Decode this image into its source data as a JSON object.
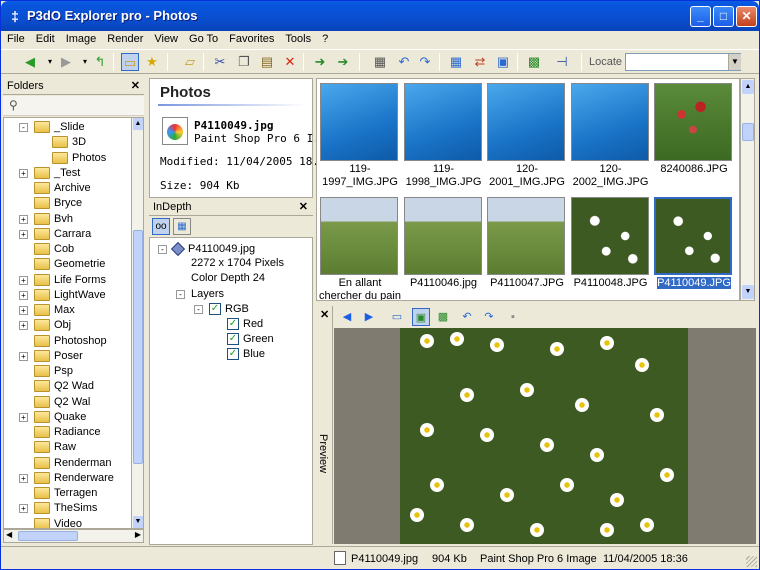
{
  "window": {
    "title": "P3dO Explorer pro - Photos",
    "app_glyph": "‡"
  },
  "menu": [
    "File",
    "Edit",
    "Image",
    "Render",
    "View",
    "Go To",
    "Favorites",
    "Tools",
    "?"
  ],
  "toolbar": {
    "locate_label": "Locate",
    "locate_value": ""
  },
  "folders": {
    "header": "Folders",
    "items": [
      {
        "label": "_Slide",
        "level": 1,
        "expand": "-"
      },
      {
        "label": "3D",
        "level": 2,
        "expand": ""
      },
      {
        "label": "Photos",
        "level": 2,
        "expand": ""
      },
      {
        "label": "_Test",
        "level": 1,
        "expand": "+"
      },
      {
        "label": "Archive",
        "level": 1,
        "expand": ""
      },
      {
        "label": "Bryce",
        "level": 1,
        "expand": ""
      },
      {
        "label": "Bvh",
        "level": 1,
        "expand": "+"
      },
      {
        "label": "Carrara",
        "level": 1,
        "expand": "+"
      },
      {
        "label": "Cob",
        "level": 1,
        "expand": ""
      },
      {
        "label": "Geometrie",
        "level": 1,
        "expand": ""
      },
      {
        "label": "Life Forms",
        "level": 1,
        "expand": "+"
      },
      {
        "label": "LightWave",
        "level": 1,
        "expand": "+"
      },
      {
        "label": "Max",
        "level": 1,
        "expand": "+"
      },
      {
        "label": "Obj",
        "level": 1,
        "expand": "+"
      },
      {
        "label": "Photoshop",
        "level": 1,
        "expand": ""
      },
      {
        "label": "Poser",
        "level": 1,
        "expand": "+"
      },
      {
        "label": "Psp",
        "level": 1,
        "expand": ""
      },
      {
        "label": "Q2 Wad",
        "level": 1,
        "expand": ""
      },
      {
        "label": "Q2 Wal",
        "level": 1,
        "expand": ""
      },
      {
        "label": "Quake",
        "level": 1,
        "expand": "+"
      },
      {
        "label": "Radiance",
        "level": 1,
        "expand": ""
      },
      {
        "label": "Raw",
        "level": 1,
        "expand": ""
      },
      {
        "label": "Renderman",
        "level": 1,
        "expand": ""
      },
      {
        "label": "Renderware",
        "level": 1,
        "expand": "+"
      },
      {
        "label": "Terragen",
        "level": 1,
        "expand": ""
      },
      {
        "label": "TheSims",
        "level": 1,
        "expand": "+"
      },
      {
        "label": "Video",
        "level": 1,
        "expand": ""
      }
    ]
  },
  "info": {
    "title": "Photos",
    "filename": "P4110049.jpg",
    "app": "Paint Shop Pro 6 I...",
    "modified": "Modified: 11/04/2005 18...",
    "size": "Size: 904 Kb"
  },
  "indepth": {
    "header": "InDepth",
    "root": "P4110049.jpg",
    "pixels": "2272 x 1704 Pixels",
    "depth": "Color Depth 24",
    "layers": "Layers",
    "rgb": "RGB",
    "channels": [
      "Red",
      "Green",
      "Blue"
    ]
  },
  "thumbnails": [
    {
      "caption": "119-1997_IMG.JPG",
      "kind": "water"
    },
    {
      "caption": "119-1998_IMG.JPG",
      "kind": "water"
    },
    {
      "caption": "120-2001_IMG.JPG",
      "kind": "water"
    },
    {
      "caption": "120-2002_IMG.JPG",
      "kind": "water"
    },
    {
      "caption": "8240086.JPG",
      "kind": "berries"
    },
    {
      "caption": "En allant chercher du pain chez Lo...",
      "kind": "field"
    },
    {
      "caption": "P4110046.jpg",
      "kind": "field"
    },
    {
      "caption": "P4110047.JPG",
      "kind": "field"
    },
    {
      "caption": "P4110048.JPG",
      "kind": "daisy"
    },
    {
      "caption": "P4110049.JPG",
      "kind": "daisy",
      "selected": true
    }
  ],
  "preview": {
    "label": "Preview"
  },
  "status": {
    "filename": "P4110049.jpg",
    "size": "904 Kb",
    "app": "Paint Shop Pro 6 Image",
    "date": "11/04/2005 18:36"
  },
  "colors": {
    "selection": "#316ac5",
    "titlebar": "#0a5ee4"
  }
}
